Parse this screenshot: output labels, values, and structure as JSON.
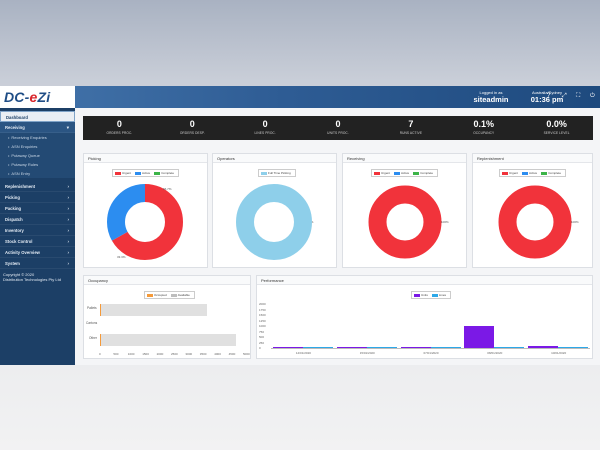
{
  "brand": {
    "prefix": "DC-",
    "accent": "e",
    "suffix": "Zi"
  },
  "sidebar": {
    "items": [
      {
        "label": "Dashboard",
        "chev": ""
      },
      {
        "label": "Receiving",
        "chev": "▾"
      },
      {
        "label": "Replenishment",
        "chev": "›"
      },
      {
        "label": "Picking",
        "chev": "›"
      },
      {
        "label": "Packing",
        "chev": "›"
      },
      {
        "label": "Dispatch",
        "chev": "›"
      },
      {
        "label": "Inventory",
        "chev": "›"
      },
      {
        "label": "Stock Control",
        "chev": "›"
      },
      {
        "label": "Activity Overview",
        "chev": "›"
      },
      {
        "label": "System",
        "chev": "›"
      }
    ],
    "subitems": [
      {
        "label": "Receiving Enquiries"
      },
      {
        "label": "ASN Enquiries"
      },
      {
        "label": "Putaway Queue"
      },
      {
        "label": "Putaway Rules"
      },
      {
        "label": "ASN Entry"
      }
    ],
    "copyright_line1": "Copyright © 2020",
    "copyright_line2": "Distribution Technologies Pty Ltd"
  },
  "topbar": {
    "logged_label": "Logged in as",
    "username": "siteadmin",
    "tz_label": "Australia/Sydney",
    "time": "01:36 pm",
    "icons": [
      "help-icon",
      "expand-icon",
      "fullscreen-icon",
      "power-icon"
    ],
    "icon_glyphs": [
      "?",
      "⤢",
      "⛶",
      "⏻"
    ]
  },
  "stats": [
    {
      "value": "0",
      "label": "ORDERS PROC."
    },
    {
      "value": "0",
      "label": "ORDERS DESP."
    },
    {
      "value": "0",
      "label": "LINES PROC."
    },
    {
      "value": "0",
      "label": "UNITS PROC."
    },
    {
      "value": "7",
      "label": "RUNS ACTIVE"
    },
    {
      "value": "0.1%",
      "label": "OCCUPANCY"
    },
    {
      "value": "0.0%",
      "label": "SERVICE LEVEL"
    }
  ],
  "colors": {
    "urgent": "#f1333b",
    "active": "#2c8df0",
    "complete": "#3cb448",
    "fulltime": "#8ecfea",
    "occupied": "#f59a3a",
    "available": "#bdbdbd",
    "units": "#7b19e6",
    "lines": "#2da8e8"
  },
  "panels": {
    "picking": {
      "title": "Picking",
      "legend": [
        "Urgent",
        "Active",
        "Complete"
      ],
      "label_a": "66.7%",
      "label_b": "33.3%"
    },
    "operators": {
      "title": "Operators",
      "legend": [
        "Full Time Picking"
      ],
      "label_a": "1"
    },
    "receiving": {
      "title": "Receiving",
      "legend": [
        "Urgent",
        "Active",
        "Complete"
      ],
      "label_a": "100%"
    },
    "replenishment": {
      "title": "Replenishment",
      "legend": [
        "Urgent",
        "Active",
        "Complete"
      ],
      "label_a": "100%"
    },
    "occupancy": {
      "title": "Occupancy",
      "legend": [
        "Occupied",
        "Available"
      ],
      "rows": [
        "Pallets",
        "Cartons",
        "Other"
      ],
      "ticks": [
        "0",
        "500",
        "1000",
        "1500",
        "2000",
        "2500",
        "3000",
        "3500",
        "4000",
        "4500",
        "5000"
      ]
    },
    "performance": {
      "title": "Performance",
      "legend": [
        "Units",
        "Lines"
      ],
      "yticks": [
        "2000",
        "1750",
        "1500",
        "1250",
        "1000",
        "750",
        "500",
        "250",
        "0"
      ],
      "xticks": [
        "14/01/2020",
        "15/01/2020",
        "07/01/2020",
        "08/01/2020",
        "10/01/2020"
      ]
    }
  },
  "chart_data": [
    {
      "type": "pie",
      "title": "Picking",
      "categories": [
        "Urgent",
        "Active",
        "Complete"
      ],
      "values": [
        66.7,
        33.3,
        0
      ]
    },
    {
      "type": "pie",
      "title": "Operators",
      "categories": [
        "Full Time Picking"
      ],
      "values": [
        1
      ]
    },
    {
      "type": "pie",
      "title": "Receiving",
      "categories": [
        "Urgent",
        "Active",
        "Complete"
      ],
      "values": [
        100,
        0,
        0
      ]
    },
    {
      "type": "pie",
      "title": "Replenishment",
      "categories": [
        "Urgent",
        "Active",
        "Complete"
      ],
      "values": [
        100,
        0,
        0
      ]
    },
    {
      "type": "bar",
      "title": "Occupancy",
      "categories": [
        "Pallets",
        "Cartons",
        "Other"
      ],
      "series": [
        {
          "name": "Occupied",
          "values": [
            5,
            0,
            5
          ]
        },
        {
          "name": "Available",
          "values": [
            3700,
            0,
            4700
          ]
        }
      ],
      "xlim": [
        0,
        5000
      ]
    },
    {
      "type": "bar",
      "title": "Performance",
      "categories": [
        "14/01/2020",
        "15/01/2020",
        "07/01/2020",
        "08/01/2020",
        "10/01/2020"
      ],
      "series": [
        {
          "name": "Units",
          "values": [
            20,
            20,
            60,
            1000,
            100
          ]
        },
        {
          "name": "Lines",
          "values": [
            5,
            5,
            10,
            20,
            10
          ]
        }
      ],
      "ylim": [
        0,
        2000
      ]
    }
  ]
}
